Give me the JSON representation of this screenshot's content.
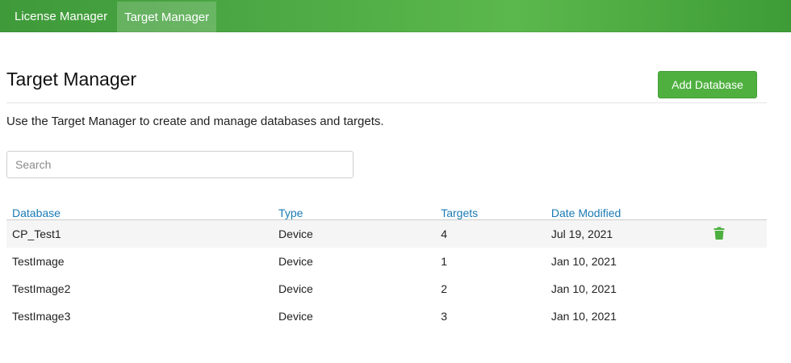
{
  "nav": {
    "tabs": [
      {
        "label": "License Manager",
        "active": false
      },
      {
        "label": "Target Manager",
        "active": true
      }
    ]
  },
  "page": {
    "title": "Target Manager",
    "add_button_label": "Add Database",
    "description": "Use the Target Manager to create and manage databases and targets."
  },
  "search": {
    "placeholder": "Search",
    "value": ""
  },
  "table": {
    "headers": [
      "Database",
      "Type",
      "Targets",
      "Date Modified"
    ],
    "rows": [
      {
        "database": "CP_Test1",
        "type": "Device",
        "targets": "4",
        "date": "Jul 19, 2021",
        "selected": true
      },
      {
        "database": "TestImage",
        "type": "Device",
        "targets": "1",
        "date": "Jan 10, 2021",
        "selected": false
      },
      {
        "database": "TestImage2",
        "type": "Device",
        "targets": "2",
        "date": "Jan 10, 2021",
        "selected": false
      },
      {
        "database": "TestImage3",
        "type": "Device",
        "targets": "3",
        "date": "Jan 10, 2021",
        "selected": false
      }
    ],
    "row_action_icon": "trash-icon"
  },
  "colors": {
    "nav_green": "#4aa743",
    "button_green": "#4fb040",
    "header_link_blue": "#1a7ab5",
    "trash_green": "#4caf3f"
  }
}
